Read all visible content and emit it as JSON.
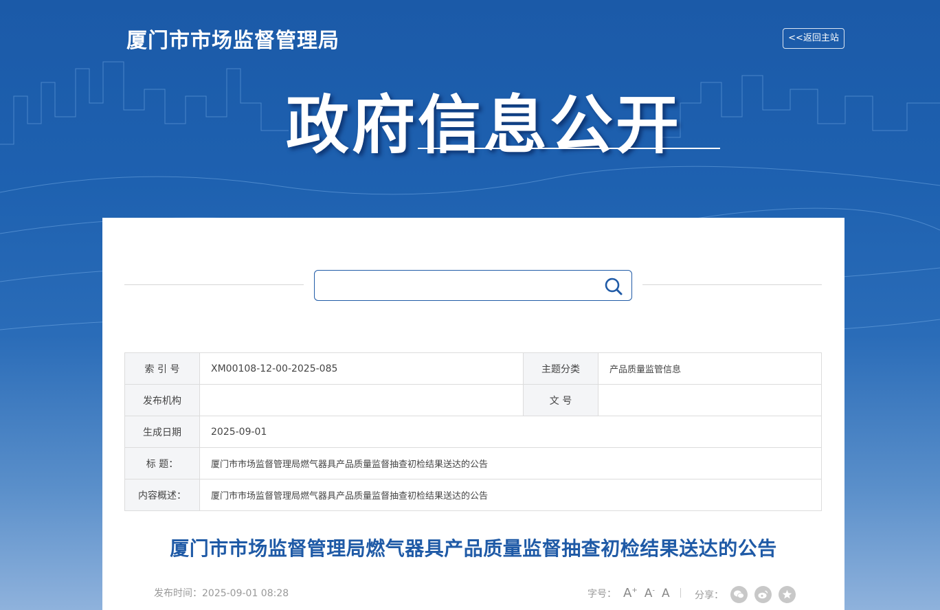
{
  "header": {
    "site_title": "厦门市市场监督管理局",
    "back_link": "<<返回主站",
    "banner": "政府信息公开"
  },
  "search": {
    "value": "",
    "placeholder": ""
  },
  "info_table": {
    "index_label": "索 引 号",
    "index_value": "XM00108-12-00-2025-085",
    "category_label": "主题分类",
    "category_value": "产品质量监管信息",
    "publisher_label": "发布机构",
    "publisher_value": "",
    "doc_no_label": "文 号",
    "doc_no_value": "",
    "date_label": "生成日期",
    "date_value": "2025-09-01",
    "title_label": "标 题：",
    "title_value": "厦门市市场监督管理局燃气器具产品质量监督抽查初检结果送达的公告",
    "summary_label": "内容概述：",
    "summary_value": "厦门市市场监督管理局燃气器具产品质量监督抽查初检结果送达的公告"
  },
  "article": {
    "title": "厦门市市场监督管理局燃气器具产品质量监督抽查初检结果送达的公告",
    "publish_time": "发布时间：2025-09-01 08:28",
    "font_size_label": "字号：",
    "font_large": "A",
    "font_large_sup": "+",
    "font_medium": "A",
    "font_medium_sup": "-",
    "font_small": "A",
    "share_label": "分享："
  },
  "colors": {
    "brand_blue": "#1f5aa6",
    "background_top": "#1b5aa8"
  },
  "icons": [
    "search-icon",
    "wechat-icon",
    "weibo-icon",
    "favorite-icon"
  ]
}
